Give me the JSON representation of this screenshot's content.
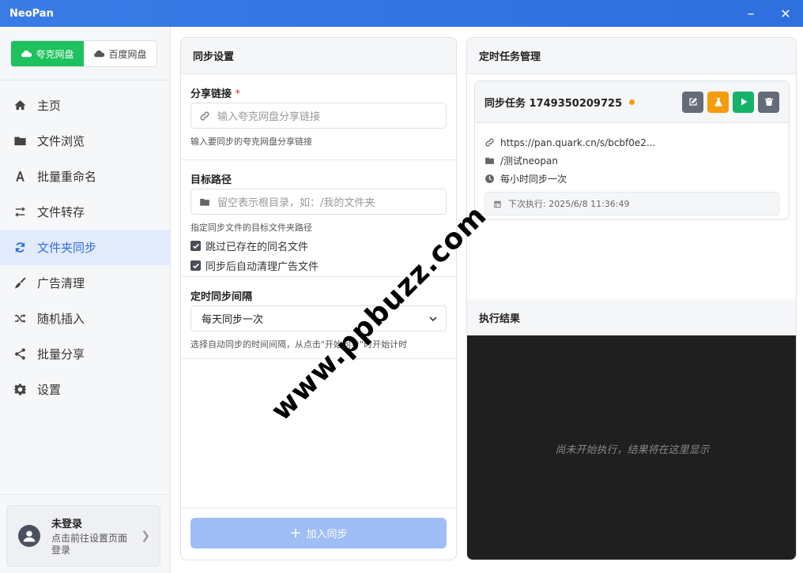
{
  "window": {
    "title": "NeoPan",
    "minimize": "–",
    "close": "✕"
  },
  "sidebar": {
    "drives": [
      {
        "label": "夸克网盘",
        "active": true,
        "icon": "cloud-icon"
      },
      {
        "label": "百度网盘",
        "active": false,
        "icon": "cloud-icon"
      }
    ],
    "items": [
      {
        "label": "主页",
        "icon": "home-icon"
      },
      {
        "label": "文件浏览",
        "icon": "folder-icon"
      },
      {
        "label": "批量重命名",
        "icon": "font-icon"
      },
      {
        "label": "文件转存",
        "icon": "exchange-icon"
      },
      {
        "label": "文件夹同步",
        "icon": "sync-icon",
        "active": true
      },
      {
        "label": "广告清理",
        "icon": "broom-icon"
      },
      {
        "label": "随机插入",
        "icon": "shuffle-icon"
      },
      {
        "label": "批量分享",
        "icon": "share-icon"
      },
      {
        "label": "设置",
        "icon": "gear-icon"
      }
    ],
    "user": {
      "name": "未登录",
      "hint": "点击前往设置页面登录"
    }
  },
  "sync": {
    "title": "同步设置",
    "share_link": {
      "label": "分享链接",
      "required_mark": "*",
      "placeholder": "输入夸克网盘分享链接",
      "help": "输入要同步的夸克网盘分享链接"
    },
    "target": {
      "label": "目标路径",
      "placeholder": "留空表示根目录，如：/我的文件夹",
      "help": "指定同步文件的目标文件夹路径"
    },
    "options": [
      {
        "label": "跳过已存在的同名文件",
        "checked": true
      },
      {
        "label": "同步后自动清理广告文件",
        "checked": true
      }
    ],
    "interval": {
      "label": "定时同步间隔",
      "selected": "每天同步一次",
      "help": "选择自动同步的时间间隔，从点击\"开始同步\"时开始计时"
    },
    "add_button": "加入同步"
  },
  "tasks": {
    "title": "定时任务管理",
    "items": [
      {
        "name": "同步任务 1749350209725",
        "status_color": "#f59c0b",
        "link": "https://pan.quark.cn/s/bcbf0e2...",
        "path": "/测试neopan",
        "schedule": "每小时同步一次",
        "next_run": "下次执行: 2025/6/8 11:36:49"
      }
    ]
  },
  "result": {
    "title": "执行结果",
    "empty": "尚未开始执行，结果将在这里显示"
  },
  "watermark": "www.ppbuzz.com",
  "colors": {
    "titlebar": "#2f6fde",
    "active_drive": "#1ec15d",
    "nav_active_bg": "#e3ebfb",
    "add_button": "#9ebef5",
    "console_bg": "#1f1f1f"
  }
}
